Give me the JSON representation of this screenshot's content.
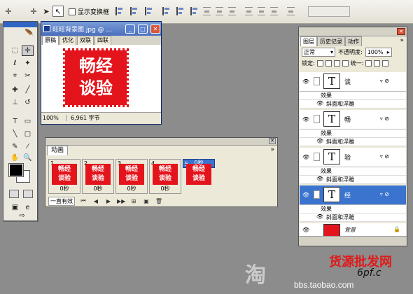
{
  "options_bar": {
    "show_transform_controls": "显示变换框"
  },
  "document": {
    "title": "旺旺背景图.jpg @ ...",
    "tabs": [
      "原稿",
      "优化",
      "双联",
      "四联"
    ],
    "zoom": "100%",
    "size": "6,961 字节",
    "stamp_line1": "畅经",
    "stamp_line2": "谈验"
  },
  "animation": {
    "tab": "动画",
    "menu_glyph": "»",
    "frames": [
      {
        "num": "1",
        "delay": "0秒",
        "text": "畅经\n谈验",
        "selected": false
      },
      {
        "num": "2",
        "delay": "0秒",
        "text": "畅经\n谈验",
        "selected": false
      },
      {
        "num": "3",
        "delay": "0秒",
        "text": "畅经\n谈验",
        "selected": false
      },
      {
        "num": "4",
        "delay": "0秒",
        "text": "畅经\n谈验",
        "selected": false
      },
      {
        "num": "5",
        "delay": "0秒",
        "text": "畅经\n谈验",
        "selected": true
      }
    ],
    "loop": "一直有效"
  },
  "layers": {
    "tabs": [
      "图层",
      "历史记录",
      "动作"
    ],
    "menu_glyph": "»",
    "blend_mode": "正常",
    "opacity_label": "不透明度:",
    "opacity_value": "100%",
    "lock_label": "锁定:",
    "unify_label": "统一:",
    "effect_label": "效果",
    "bevel_label": "斜面和浮雕",
    "items": [
      {
        "name": "谈",
        "type": "text",
        "selected": false
      },
      {
        "name": "畅",
        "type": "text",
        "selected": false
      },
      {
        "name": "验",
        "type": "text",
        "selected": false
      },
      {
        "name": "经",
        "type": "text",
        "selected": true
      },
      {
        "name": "背景",
        "type": "image",
        "selected": false
      }
    ]
  },
  "watermark": {
    "cn": "货源批发网",
    "url": "bbs.taobao.com",
    "mark": "6pf.c"
  }
}
